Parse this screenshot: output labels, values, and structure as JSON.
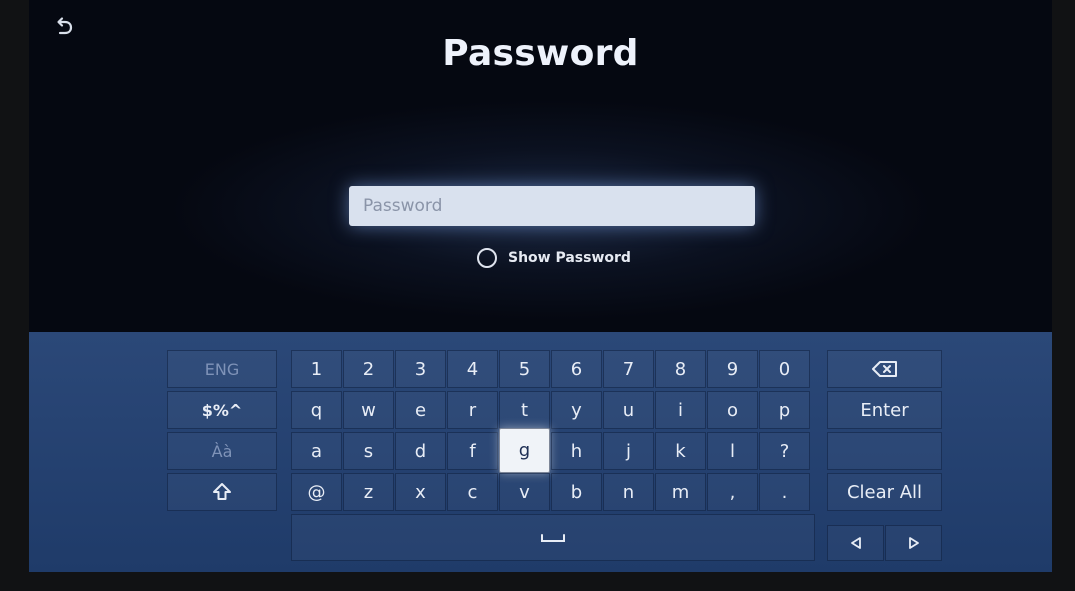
{
  "title": "Password",
  "password_field": {
    "placeholder": "Password",
    "value": ""
  },
  "show_password": {
    "label": "Show Password"
  },
  "keyboard": {
    "side": {
      "language": "ENG",
      "symbols": "$%^",
      "accent": "Àà"
    },
    "numbers": [
      "1",
      "2",
      "3",
      "4",
      "5",
      "6",
      "7",
      "8",
      "9",
      "0"
    ],
    "row_q": [
      "q",
      "w",
      "e",
      "r",
      "t",
      "y",
      "u",
      "i",
      "o",
      "p"
    ],
    "row_a": [
      "a",
      "s",
      "d",
      "f",
      "g",
      "h",
      "j",
      "k",
      "l",
      "?"
    ],
    "row_z": [
      "@",
      "z",
      "x",
      "c",
      "v",
      "b",
      "n",
      "m",
      ",",
      "."
    ],
    "focused_key": "g",
    "actions": {
      "enter": "Enter",
      "clear_all": "Clear All"
    }
  }
}
